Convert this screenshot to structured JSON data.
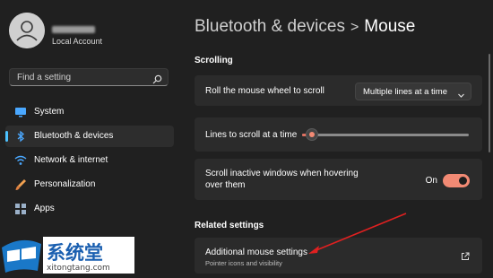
{
  "sidebar": {
    "account_label": "Local Account",
    "search_placeholder": "Find a setting",
    "items": [
      {
        "label": "System",
        "icon": "monitor-icon"
      },
      {
        "label": "Bluetooth & devices",
        "icon": "bluetooth-icon",
        "active": true
      },
      {
        "label": "Network & internet",
        "icon": "wifi-icon"
      },
      {
        "label": "Personalization",
        "icon": "brush-icon"
      },
      {
        "label": "Apps",
        "icon": "apps-icon"
      }
    ]
  },
  "header": {
    "parent": "Bluetooth & devices",
    "separator": ">",
    "current": "Mouse"
  },
  "scrolling": {
    "section_label": "Scrolling",
    "roll_label": "Roll the mouse wheel to scroll",
    "roll_value": "Multiple lines at a time",
    "lines_label": "Lines to scroll at a time",
    "lines_value_fraction": 0.06,
    "inactive_label_line1": "Scroll inactive windows when hovering",
    "inactive_label_line2": "over them",
    "inactive_state": "On"
  },
  "related": {
    "section_label": "Related settings",
    "additional_label": "Additional mouse settings",
    "additional_sub": "Pointer icons and visibility"
  },
  "watermark": {
    "title": "系统堂",
    "url": "xitongtang.com"
  },
  "colors": {
    "accent": "#f28a74",
    "nav_indicator": "#4cc2ff",
    "annotation_arrow": "#e02020"
  }
}
